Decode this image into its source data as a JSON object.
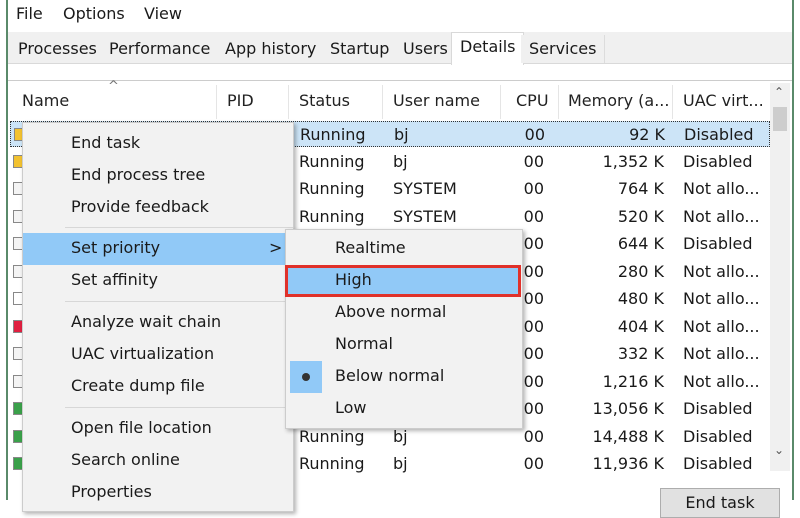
{
  "menubar": [
    "File",
    "Options",
    "View"
  ],
  "tabs": [
    "Processes",
    "Performance",
    "App history",
    "Startup",
    "Users",
    "Details",
    "Services"
  ],
  "active_tab": "Details",
  "columns": [
    "Name",
    "PID",
    "Status",
    "User name",
    "CPU",
    "Memory (a...",
    "UAC virt..."
  ],
  "rows": [
    {
      "status": "Running",
      "user": "bj",
      "cpu": "00",
      "mem": "92 K",
      "uac": "Disabled"
    },
    {
      "status": "Running",
      "user": "bj",
      "cpu": "00",
      "mem": "1,352 K",
      "uac": "Disabled"
    },
    {
      "status": "Running",
      "user": "SYSTEM",
      "cpu": "00",
      "mem": "764 K",
      "uac": "Not allo..."
    },
    {
      "status": "Running",
      "user": "SYSTEM",
      "cpu": "00",
      "mem": "520 K",
      "uac": "Not allo..."
    },
    {
      "status": "",
      "user": "",
      "cpu": "00",
      "mem": "644 K",
      "uac": "Disabled"
    },
    {
      "status": "",
      "user": "",
      "cpu": "00",
      "mem": "280 K",
      "uac": "Not allo..."
    },
    {
      "status": "",
      "user": "",
      "cpu": "00",
      "mem": "480 K",
      "uac": "Not allo..."
    },
    {
      "status": "",
      "user": "",
      "cpu": "00",
      "mem": "404 K",
      "uac": "Not allo..."
    },
    {
      "status": "",
      "user": "",
      "cpu": "00",
      "mem": "332 K",
      "uac": "Not allo..."
    },
    {
      "status": "",
      "user": "",
      "cpu": "00",
      "mem": "1,216 K",
      "uac": "Not allo..."
    },
    {
      "status": "",
      "user": "",
      "cpu": "00",
      "mem": "13,056 K",
      "uac": "Disabled"
    },
    {
      "status": "Running",
      "user": "bj",
      "cpu": "00",
      "mem": "14,488 K",
      "uac": "Disabled"
    },
    {
      "status": "Running",
      "user": "bj",
      "cpu": "00",
      "mem": "11,936 K",
      "uac": "Disabled"
    }
  ],
  "context_menu": [
    "End task",
    "End process tree",
    "Provide feedback",
    "Set priority",
    "Set affinity",
    "Analyze wait chain",
    "UAC virtualization",
    "Create dump file",
    "Open file location",
    "Search online",
    "Properties"
  ],
  "submenu_arrow": ">",
  "priority_menu": [
    "Realtime",
    "High",
    "Above normal",
    "Normal",
    "Below normal",
    "Low"
  ],
  "selected_priority": "Below normal",
  "highlighted_priority": "High",
  "end_task_button": "End task",
  "colors": {
    "highlight": "#91c9f7",
    "callout": "#e0312a",
    "selection": "#cce4f7"
  }
}
